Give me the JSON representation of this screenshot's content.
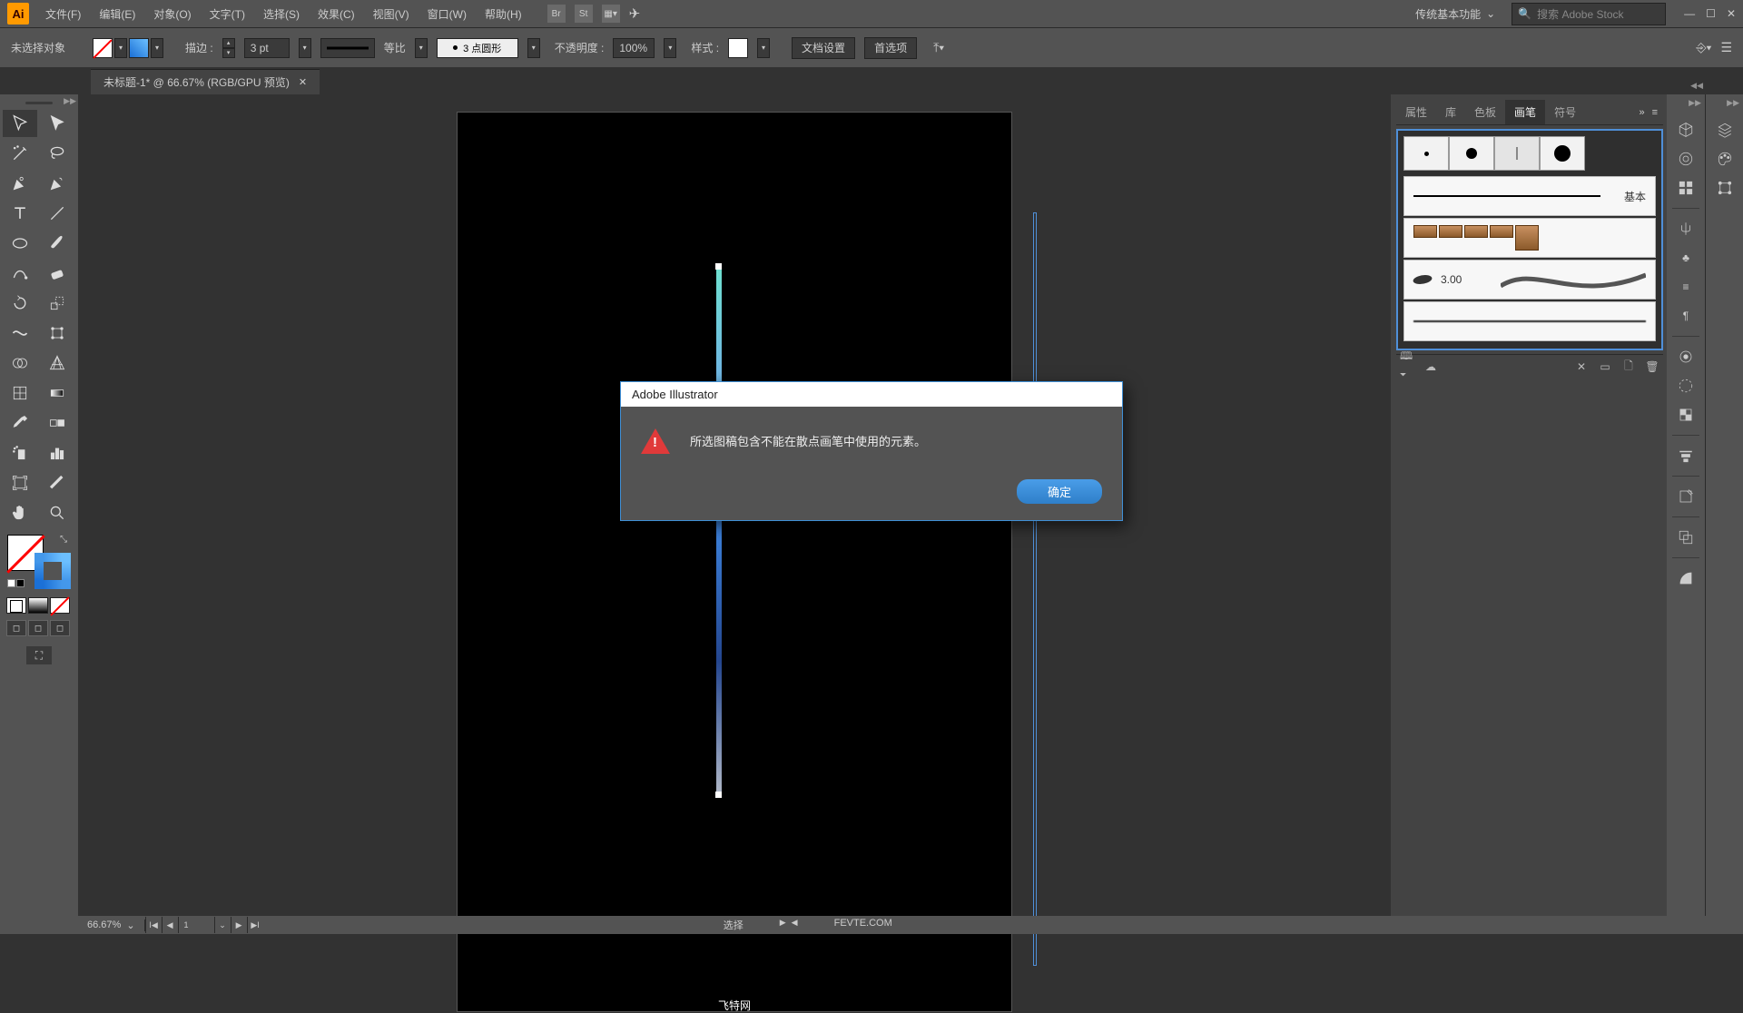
{
  "app": {
    "logo": "Ai"
  },
  "menu": [
    "文件(F)",
    "编辑(E)",
    "对象(O)",
    "文字(T)",
    "选择(S)",
    "效果(C)",
    "视图(V)",
    "窗口(W)",
    "帮助(H)"
  ],
  "topIcons": [
    "Br",
    "St"
  ],
  "workspace": {
    "label": "传统基本功能"
  },
  "search": {
    "placeholder": "搜索 Adobe Stock"
  },
  "control": {
    "noSelection": "未选择对象",
    "strokeLabel": "描边 :",
    "strokeWidth": "3 pt",
    "profile": "等比",
    "brushDef": "3 点圆形",
    "opacityLabel": "不透明度 :",
    "opacity": "100%",
    "styleLabel": "样式 :",
    "docSetup": "文档设置",
    "prefs": "首选项"
  },
  "tab": {
    "title": "未标题-1* @ 66.67% (RGB/GPU 预览)"
  },
  "panel": {
    "tabs": [
      "属性",
      "库",
      "色板",
      "画笔",
      "符号"
    ],
    "activeTab": 3,
    "basicLabel": "基本",
    "calligValue": "3.00",
    "moreLabel": "»"
  },
  "dialog": {
    "title": "Adobe Illustrator",
    "message": "所选图稿包含不能在散点画笔中使用的元素。",
    "ok": "确定"
  },
  "status": {
    "zoom": "66.67%",
    "artboard": "1",
    "tool": "选择",
    "site1": "飞特网",
    "site2": "FEVTE.COM"
  }
}
